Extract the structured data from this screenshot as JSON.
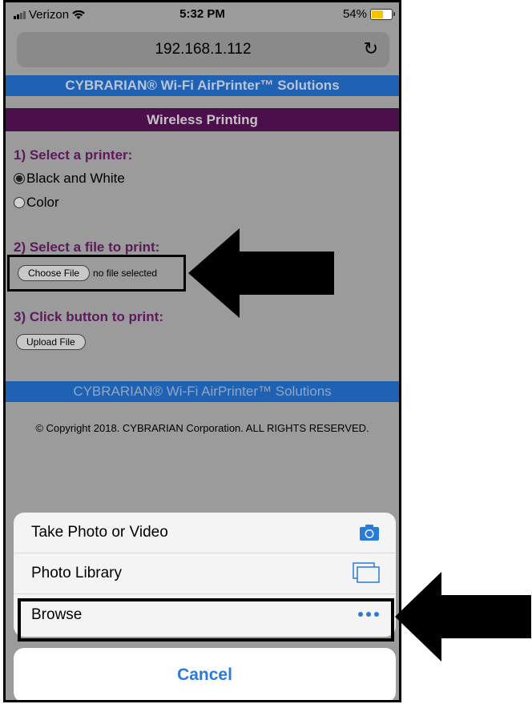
{
  "status_bar": {
    "carrier": "Verizon",
    "time": "5:32 PM",
    "battery": "54%"
  },
  "browser": {
    "url": "192.168.1.112",
    "reload_icon": "reload-icon"
  },
  "page": {
    "banner_top": "CYBRARIAN® Wi-Fi AirPrinter™ Solutions",
    "section_title": "Wireless Printing",
    "step1": {
      "heading": "1) Select a printer:",
      "options": [
        {
          "label": "Black and White",
          "selected": true
        },
        {
          "label": "Color",
          "selected": false
        }
      ]
    },
    "step2": {
      "heading": "2) Select a file to print:",
      "button": "Choose File",
      "status": "no file selected"
    },
    "step3": {
      "heading": "3) Click button to print:",
      "button": "Upload File"
    },
    "banner_bottom": "CYBRARIAN® Wi-Fi AirPrinter™ Solutions",
    "copyright": "© Copyright 2018. CYBRARIAN Corporation. ALL RIGHTS RESERVED."
  },
  "action_sheet": {
    "items": [
      {
        "label": "Take Photo or Video",
        "icon": "camera-icon"
      },
      {
        "label": "Photo Library",
        "icon": "photo-library-icon"
      },
      {
        "label": "Browse",
        "icon": "more-icon"
      }
    ],
    "cancel": "Cancel"
  },
  "colors": {
    "banner_blue": "#1f62b3",
    "banner_purple": "#4b0f4b",
    "heading_purple": "#5c1a5c",
    "ios_blue": "#2a7ad6"
  }
}
